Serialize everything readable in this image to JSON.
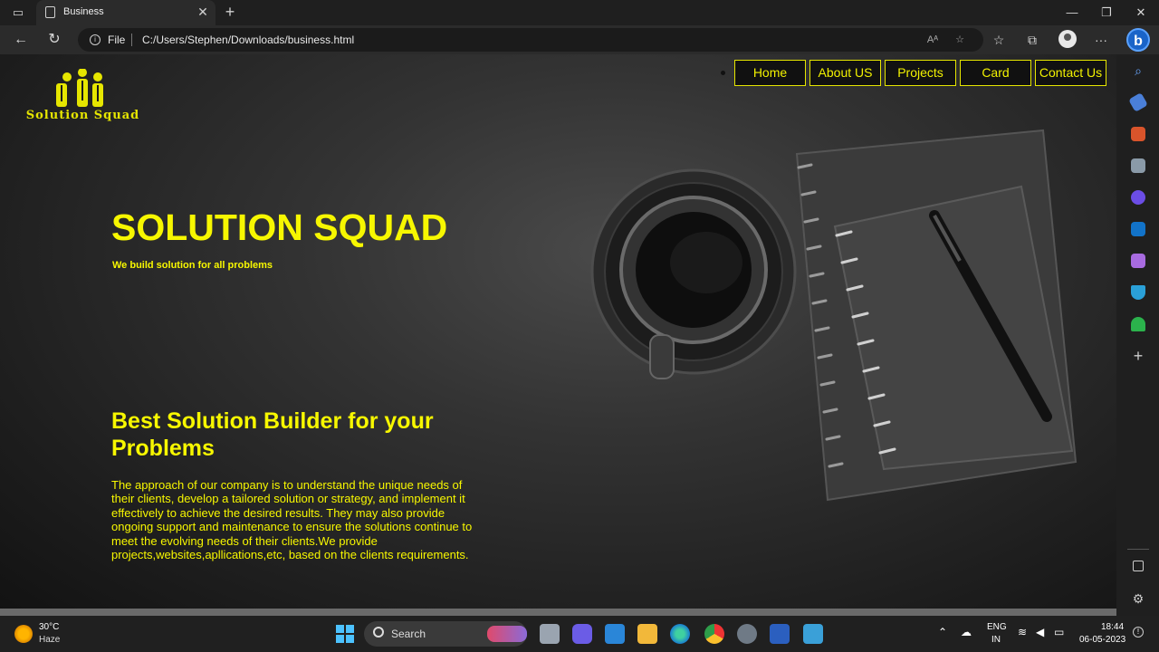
{
  "browser": {
    "tab_title": "Business",
    "address_scheme": "File",
    "address_url": "C:/Users/Stephen/Downloads/business.html"
  },
  "site": {
    "logo_text": "Solution Squad",
    "nav": [
      "Home",
      "About US",
      "Projects",
      "Card",
      "Contact Us"
    ],
    "hero_title": "SOLUTION SQUAD",
    "hero_subtitle": "We build solution for all problems",
    "section_title": "Best Solution Builder for your Problems",
    "section_body": "The approach of our company is to understand the unique needs of their clients, develop a tailored solution or strategy, and implement it effectively to achieve the desired results. They may also provide ongoing support and maintenance to ensure the solutions continue to meet the evolving needs of their clients.We provide projects,websites,apllications,etc, based on the clients requirements.",
    "accent_color": "#f7f700"
  },
  "taskbar": {
    "weather_temp": "30°C",
    "weather_condition": "Haze",
    "search_label": "Search",
    "lang_line1": "ENG",
    "lang_line2": "IN",
    "time": "18:44",
    "date": "06-05-2023"
  }
}
